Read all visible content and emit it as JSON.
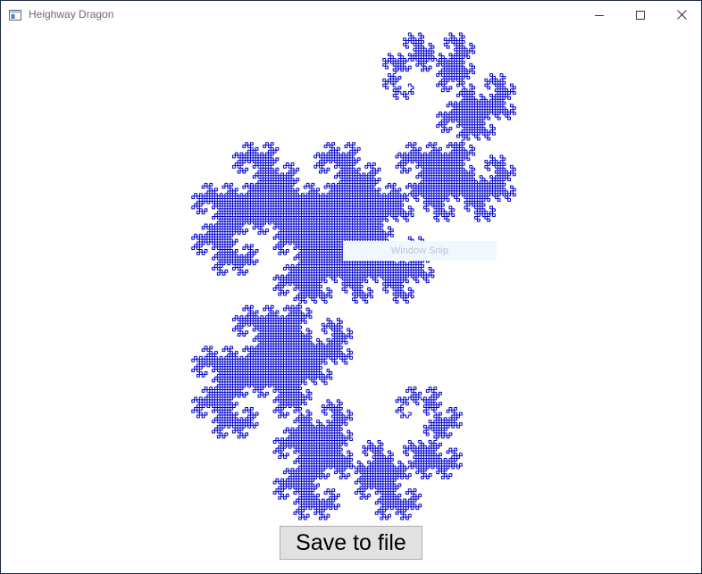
{
  "window": {
    "title": "Heighway Dragon",
    "icon": "app-window-icon",
    "controls": {
      "minimize_icon": "minimize-icon",
      "maximize_icon": "maximize-icon",
      "close_icon": "close-icon"
    }
  },
  "fractal": {
    "name": "Heighway Dragon",
    "stroke_color": "#0000cc",
    "background": "#ffffff"
  },
  "overlay": {
    "label": "Window Snip"
  },
  "actions": {
    "save_label": "Save to file"
  },
  "colors": {
    "window_border": "#1f2a44",
    "title_text": "#6b6b6b",
    "button_face": "#e1e1e1",
    "button_border": "#adadad"
  }
}
